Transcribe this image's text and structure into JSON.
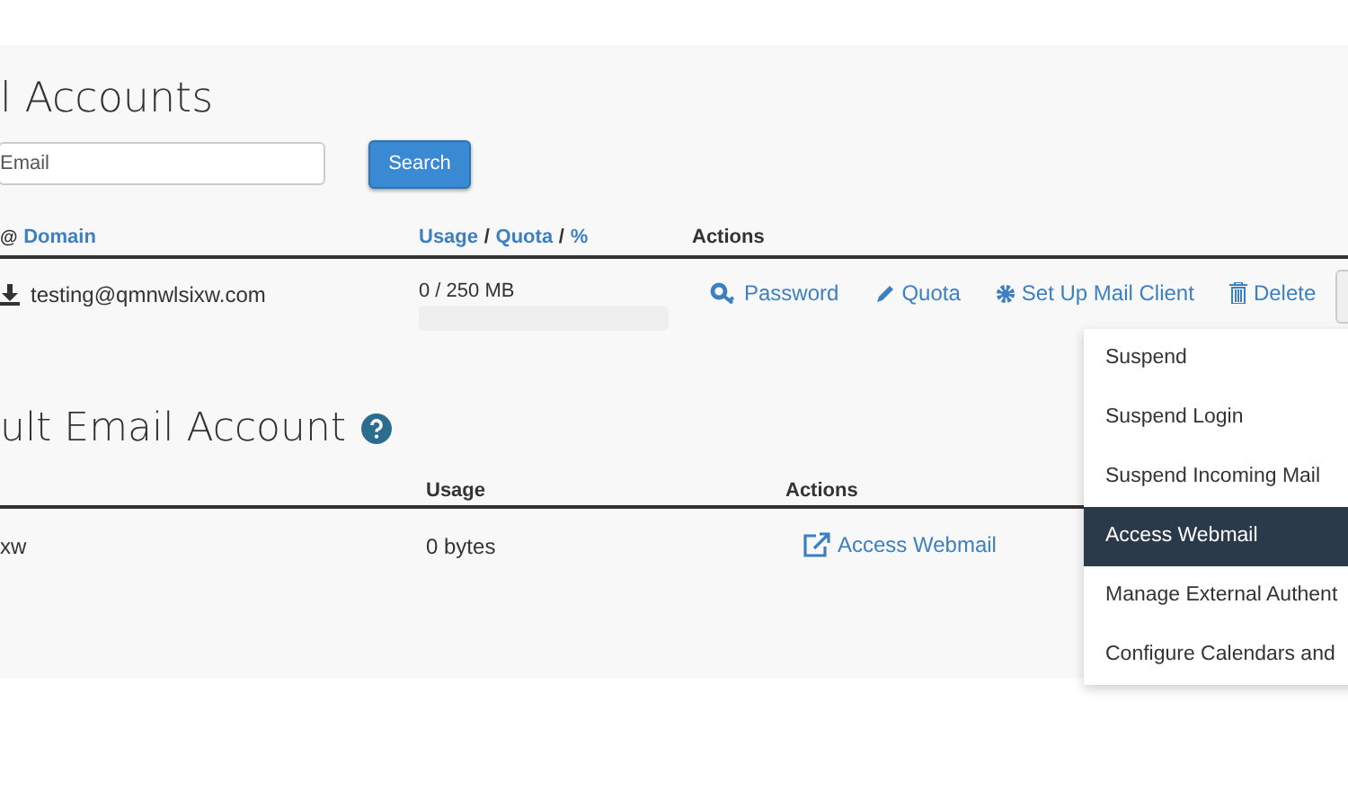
{
  "accounts_section": {
    "title": "l Accounts",
    "search": {
      "placeholder": "Email",
      "button": "Search"
    },
    "columns": {
      "at": "@",
      "domain": "Domain",
      "usage": "Usage",
      "quota": "Quota",
      "percent": "%",
      "actions": "Actions",
      "sep": "/"
    },
    "rows": [
      {
        "email": "testing@qmnwlsixw.com",
        "usage": "0 / 250 MB",
        "actions": [
          {
            "kind": "password",
            "label": "Password"
          },
          {
            "kind": "quota",
            "label": "Quota"
          },
          {
            "kind": "setup",
            "label": "Set Up Mail Client"
          },
          {
            "kind": "delete",
            "label": "Delete"
          }
        ]
      }
    ]
  },
  "default_section": {
    "title": "ult Email Account",
    "columns": {
      "usage": "Usage",
      "actions": "Actions"
    },
    "rows": [
      {
        "account": "xw",
        "usage": "0 bytes",
        "action": "Access Webmail"
      }
    ]
  },
  "dropdown_menu": [
    {
      "label": "Suspend",
      "selected": false
    },
    {
      "label": "Suspend Login",
      "selected": false
    },
    {
      "label": "Suspend Incoming Mail",
      "selected": false
    },
    {
      "label": "Access Webmail",
      "selected": true
    },
    {
      "label": "Manage External Authent",
      "selected": false
    },
    {
      "label": "Configure Calendars and",
      "selected": false
    }
  ]
}
